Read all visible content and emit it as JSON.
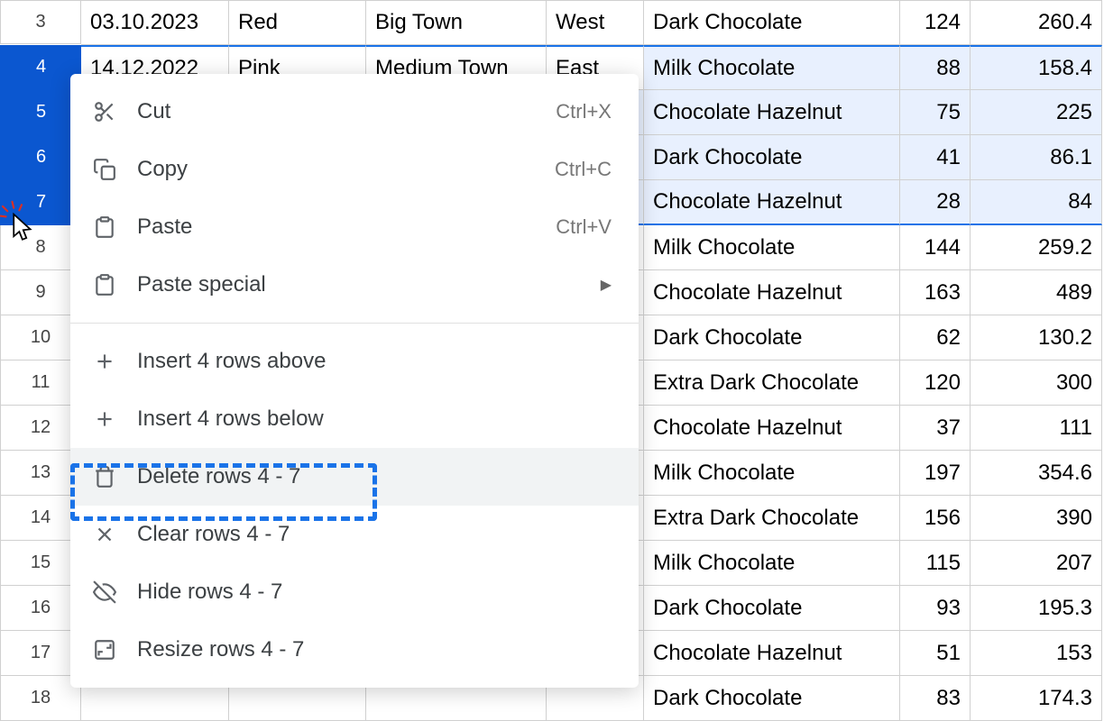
{
  "rows": [
    {
      "num": "3",
      "date": "03.10.2023",
      "color": "Red",
      "town": "Big Town",
      "region": "West",
      "product": "Dark Chocolate",
      "qty": "124",
      "amt": "260.4",
      "sel": false
    },
    {
      "num": "4",
      "date": "14.12.2022",
      "color": "Pink",
      "town": "Medium Town",
      "region": "East",
      "product": "Milk Chocolate",
      "qty": "88",
      "amt": "158.4",
      "sel": true
    },
    {
      "num": "5",
      "date": "",
      "color": "",
      "town": "",
      "region": "",
      "product": "Chocolate Hazelnut",
      "qty": "75",
      "amt": "225",
      "sel": true
    },
    {
      "num": "6",
      "date": "",
      "color": "",
      "town": "",
      "region": "",
      "product": "Dark Chocolate",
      "qty": "41",
      "amt": "86.1",
      "sel": true
    },
    {
      "num": "7",
      "date": "",
      "color": "",
      "town": "",
      "region": "",
      "product": "Chocolate Hazelnut",
      "qty": "28",
      "amt": "84",
      "sel": true
    },
    {
      "num": "8",
      "date": "",
      "color": "",
      "town": "",
      "region": "",
      "product": "Milk Chocolate",
      "qty": "144",
      "amt": "259.2",
      "sel": false
    },
    {
      "num": "9",
      "date": "",
      "color": "",
      "town": "",
      "region": "",
      "product": "Chocolate Hazelnut",
      "qty": "163",
      "amt": "489",
      "sel": false
    },
    {
      "num": "10",
      "date": "",
      "color": "",
      "town": "",
      "region": "",
      "product": "Dark Chocolate",
      "qty": "62",
      "amt": "130.2",
      "sel": false
    },
    {
      "num": "11",
      "date": "",
      "color": "",
      "town": "",
      "region": "",
      "product": "Extra Dark Chocolate",
      "qty": "120",
      "amt": "300",
      "sel": false
    },
    {
      "num": "12",
      "date": "",
      "color": "",
      "town": "",
      "region": "",
      "product": "Chocolate Hazelnut",
      "qty": "37",
      "amt": "111",
      "sel": false
    },
    {
      "num": "13",
      "date": "",
      "color": "",
      "town": "",
      "region": "",
      "product": "Milk Chocolate",
      "qty": "197",
      "amt": "354.6",
      "sel": false
    },
    {
      "num": "14",
      "date": "",
      "color": "",
      "town": "",
      "region": "",
      "product": "Extra Dark Chocolate",
      "qty": "156",
      "amt": "390",
      "sel": false
    },
    {
      "num": "15",
      "date": "",
      "color": "",
      "town": "",
      "region": "",
      "product": "Milk Chocolate",
      "qty": "115",
      "amt": "207",
      "sel": false
    },
    {
      "num": "16",
      "date": "",
      "color": "",
      "town": "",
      "region": "",
      "product": "Dark Chocolate",
      "qty": "93",
      "amt": "195.3",
      "sel": false
    },
    {
      "num": "17",
      "date": "",
      "color": "",
      "town": "",
      "region": "",
      "product": "Chocolate Hazelnut",
      "qty": "51",
      "amt": "153",
      "sel": false
    },
    {
      "num": "18",
      "date": "",
      "color": "",
      "town": "",
      "region": "",
      "product": "Dark Chocolate",
      "qty": "83",
      "amt": "174.3",
      "sel": false
    }
  ],
  "menu": {
    "cut": {
      "label": "Cut",
      "shortcut": "Ctrl+X"
    },
    "copy": {
      "label": "Copy",
      "shortcut": "Ctrl+C"
    },
    "paste": {
      "label": "Paste",
      "shortcut": "Ctrl+V"
    },
    "paste_special": {
      "label": "Paste special"
    },
    "insert_above": {
      "label": "Insert 4 rows above"
    },
    "insert_below": {
      "label": "Insert 4 rows below"
    },
    "delete": {
      "label": "Delete rows 4 - 7"
    },
    "clear": {
      "label": "Clear rows 4 - 7"
    },
    "hide": {
      "label": "Hide rows 4 - 7"
    },
    "resize": {
      "label": "Resize rows 4 - 7"
    }
  }
}
